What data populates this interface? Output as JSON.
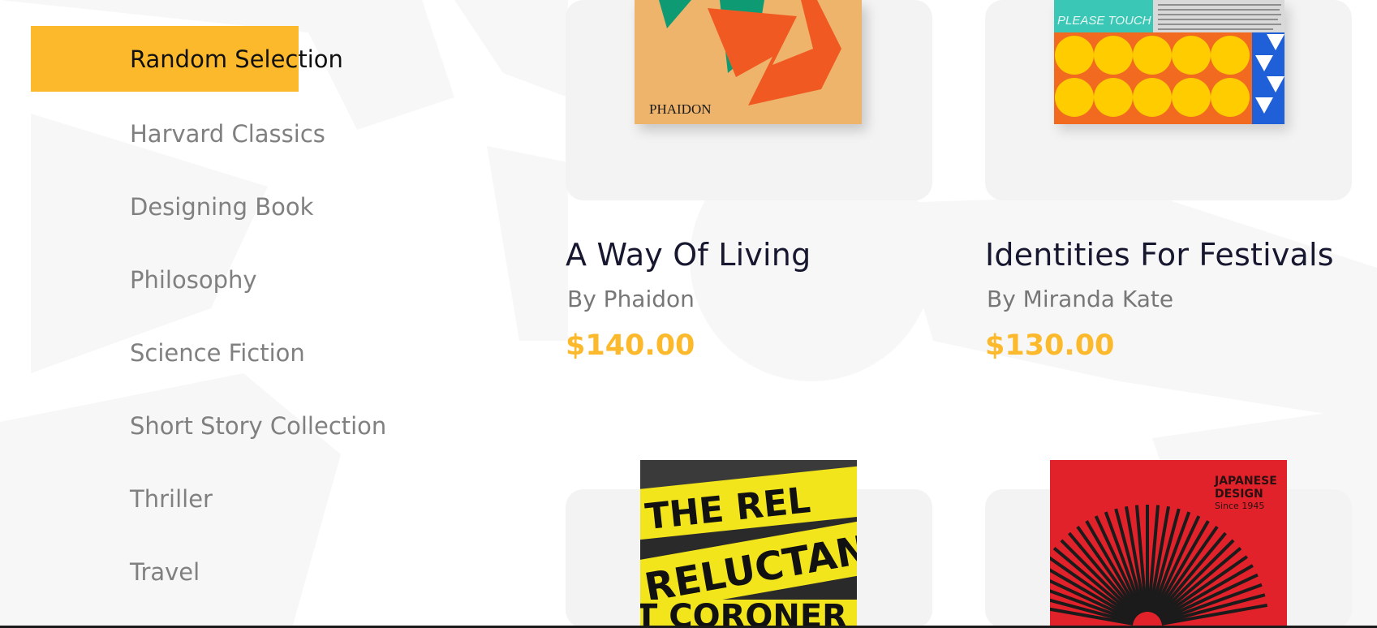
{
  "theme": {
    "accent": "#fbb92b",
    "price_color": "#fbb92b",
    "title_color": "#171730"
  },
  "categories": {
    "items": [
      {
        "label": "Random Selection",
        "active": true
      },
      {
        "label": "Harvard Classics",
        "active": false
      },
      {
        "label": "Designing Book",
        "active": false
      },
      {
        "label": "Philosophy",
        "active": false
      },
      {
        "label": "Science Fiction",
        "active": false
      },
      {
        "label": "Short Story Collection",
        "active": false
      },
      {
        "label": "Thriller",
        "active": false
      },
      {
        "label": "Travel",
        "active": false
      }
    ]
  },
  "products": [
    {
      "title": "A Way Of Living",
      "author": "By Phaidon",
      "price": "$140.00",
      "cover_text": "PHAIDON"
    },
    {
      "title": "Identities For Festivals",
      "author": "By Miranda Kate",
      "price": "$130.00",
      "cover_text": "PLEASE TOUCH"
    },
    {
      "title": "",
      "author": "",
      "price": "",
      "cover_text_top": "THE REL",
      "cover_text_mid": "RELUCTANT",
      "cover_text_bot": "T CORONER"
    },
    {
      "title": "",
      "author": "",
      "price": "",
      "cover_text": "JAPANESE DESIGN",
      "cover_subtext": "Since 1945"
    }
  ]
}
